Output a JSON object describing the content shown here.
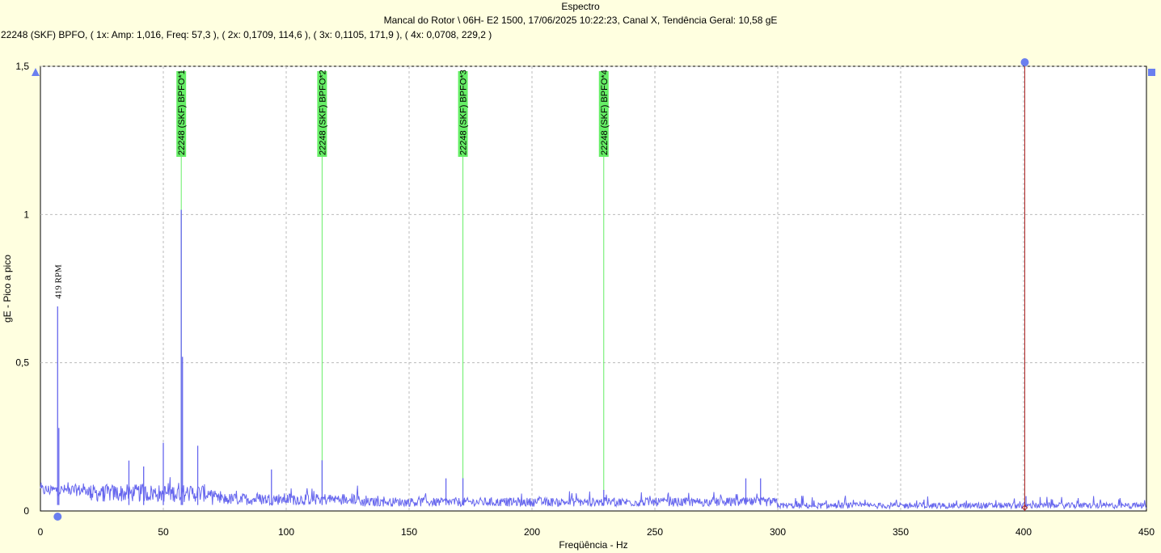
{
  "title": "Espectro",
  "subtitle": "Mancal do Rotor \\ 06H- E2 1500, 17/06/2025 10:22:23, Canal X, Tendência Geral: 10,58 gE",
  "info_line": "22248 (SKF) BPFO, ( 1x: Amp: 1,016, Freq: 57,3 ), ( 2x: 0,1709, 114,6 ), ( 3x: 0,1105, 171,9 ), ( 4x: 0,0708, 229,2 )",
  "colors": {
    "background": "#FFFFE0",
    "plot_area": "#FFFFFF",
    "spectrum": "#6666EE",
    "marker_line": "#66EE66",
    "marker_label_bg": "#66EE66",
    "cursor": "#AA2222",
    "handle": "#6A7FEF"
  },
  "chart_data": {
    "type": "line",
    "title": "Espectro",
    "xlabel": "Freqüência - Hz",
    "ylabel": "gE - Pico a pico",
    "xlim": [
      0,
      450
    ],
    "ylim": [
      0,
      1.5
    ],
    "x_ticks": [
      "0",
      "50",
      "100",
      "150",
      "200",
      "250",
      "300",
      "350",
      "400",
      "450"
    ],
    "x_tick_values": [
      0,
      50,
      100,
      150,
      200,
      250,
      300,
      350,
      400,
      450
    ],
    "y_ticks": [
      "0",
      "0,5",
      "1",
      "1,5"
    ],
    "y_tick_values": [
      0,
      0.5,
      1,
      1.5
    ],
    "grid": true,
    "series": [
      {
        "noise_floor": 0.04,
        "peaks": [
          {
            "x": 7,
            "y": 0.69
          },
          {
            "x": 7.5,
            "y": 0.28
          },
          {
            "x": 36,
            "y": 0.17
          },
          {
            "x": 42,
            "y": 0.15
          },
          {
            "x": 50,
            "y": 0.23
          },
          {
            "x": 57.3,
            "y": 1.016
          },
          {
            "x": 57.8,
            "y": 0.52
          },
          {
            "x": 64,
            "y": 0.22
          },
          {
            "x": 94,
            "y": 0.14
          },
          {
            "x": 114.6,
            "y": 0.1709
          },
          {
            "x": 165,
            "y": 0.11
          },
          {
            "x": 171.9,
            "y": 0.1105
          },
          {
            "x": 229.2,
            "y": 0.0708
          },
          {
            "x": 287,
            "y": 0.11
          },
          {
            "x": 293,
            "y": 0.11
          },
          {
            "x": 401,
            "y": 0.05
          }
        ]
      }
    ],
    "markers": [
      {
        "x": 57.3,
        "label": "22248 (SKF) BPFO*1"
      },
      {
        "x": 114.6,
        "label": "22248 (SKF) BPFO*2"
      },
      {
        "x": 171.9,
        "label": "22248 (SKF) BPFO*3"
      },
      {
        "x": 229.2,
        "label": "22248 (SKF) BPFO*4"
      }
    ],
    "annotations": [
      {
        "x": 7,
        "y": 0.71,
        "text": "419 RPM"
      }
    ],
    "cursor_x": 400.5
  }
}
